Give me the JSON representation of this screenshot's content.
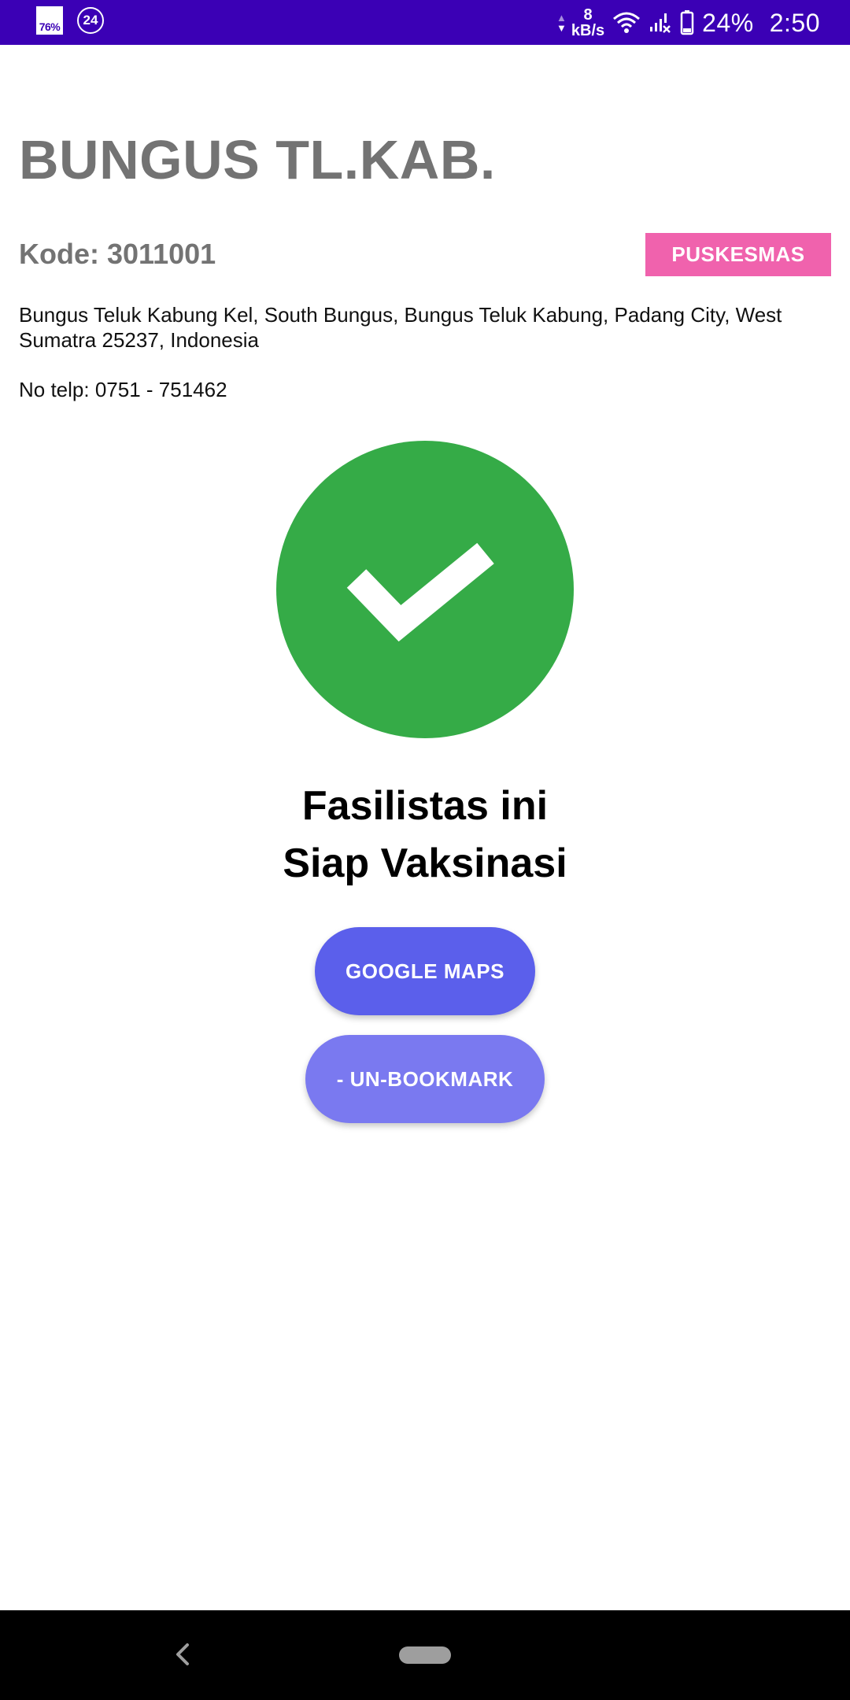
{
  "status_bar": {
    "notif_battery_label": "76%",
    "notif_badge_label": "24",
    "net_speed_value": "8",
    "net_speed_unit": "kB/s",
    "battery_percent": "24%",
    "time": "2:50",
    "icons": [
      "battery-saver-icon",
      "alarm-24-icon",
      "data-arrows-icon",
      "wifi-icon",
      "signal-no-sim-icon",
      "battery-icon"
    ]
  },
  "facility": {
    "name": "BUNGUS TL.KAB.",
    "code_line": "Kode: 3011001",
    "type_badge": "PUSKESMAS",
    "address": "Bungus Teluk Kabung Kel, South Bungus, Bungus Teluk Kabung, Padang City, West Sumatra 25237, Indonesia",
    "phone_line": "No telp: 0751 - 751462"
  },
  "status": {
    "icon": "check-circle-icon",
    "line1": "Fasilistas ini",
    "line2": "Siap Vaksinasi",
    "color": "#35ab47"
  },
  "actions": {
    "maps_label": "GOOGLE MAPS",
    "unbookmark_label": "- UN-BOOKMARK"
  },
  "nav_bar": {
    "icons": [
      "back-icon",
      "home-pill-icon"
    ]
  },
  "colors": {
    "status_bar": "#3b00b5",
    "badge": "#f062ad",
    "maps_button": "#5b5feb",
    "unbookmark_button": "#7a79f0",
    "title_gray": "#737373"
  }
}
